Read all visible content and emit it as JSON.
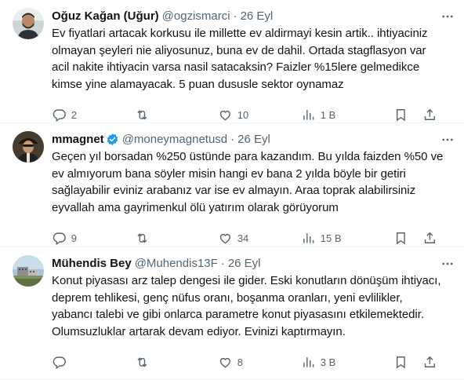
{
  "tweets": [
    {
      "name": "Oğuz Kağan (Uğur)",
      "handle": "@ogzismarci",
      "time": "26 Eyl",
      "verified": false,
      "text": "Ev fiyatlari artacak korkusu ile millette ev aldirmayi kesin artik.. ihtiyaciniz\nolmayan şeyleri nie aliyosunuz, buna ev de dahil. Ortada stagflasyon var\nacil nakite ihtiyacin varsa nasil satacaksin? Faizler %15lere gelmedikce\nkimse yine alamayacak. 5 puan dususle sektor oynamaz",
      "replies": "2",
      "retweets": "",
      "likes": "10",
      "views": "1 B",
      "avatar_icon": "avatar-man-beard"
    },
    {
      "name": "mmagnet",
      "handle": "@moneymagnetusd",
      "time": "26 Eyl",
      "verified": true,
      "text": "Geçen yıl borsadan %250 üstünde para kazandım. Bu yılda faizden %50 ve\nev almıyorum bana söyler misin hangi ev bana 2 yılda böyle bir getiri\nsağlayabilir eviniz arabanız var ise ev almayın. Araa toprak alabilirsiniz\neyvallah ama gayrimenkul ölü yatırım olarak görüyorum",
      "replies": "9",
      "retweets": "",
      "likes": "34",
      "views": "15 B",
      "avatar_icon": "avatar-man-hat"
    },
    {
      "name": "Mühendis Bey",
      "handle": "@Muhendis13F",
      "time": "26 Eyl",
      "verified": false,
      "text": "Konut piyasası arz talep dengesi ile gider. Eski konutların dönüşüm ihtiyacı,\ndeprem tehlikesi, genç nüfus oranı, boşanma oranları, yeni evlilikler,\nyabancı talebi ve gibi onlarca parametre konut piyasasını etkilemektedir.\nOlumsuzluklar artarak devam ediyor. Evinizi kaptırmayın.",
      "replies": "",
      "retweets": "",
      "likes": "8",
      "views": "3 B",
      "avatar_icon": "avatar-building-landscape"
    }
  ],
  "colors": {
    "text": "#0f1419",
    "secondary": "#536471",
    "verified": "#1d9bf0",
    "border": "#eff3f4"
  },
  "icons": [
    "reply-icon",
    "retweet-icon",
    "like-icon",
    "views-icon",
    "bookmark-icon",
    "share-icon",
    "more-icon",
    "verified-icon"
  ]
}
